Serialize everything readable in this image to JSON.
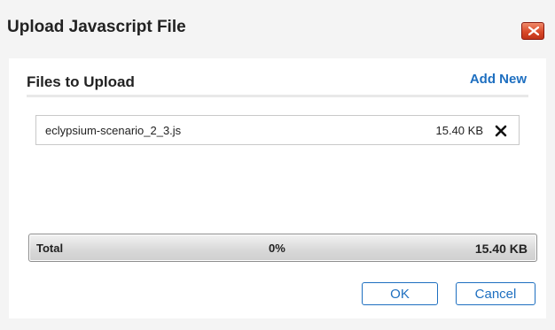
{
  "dialog": {
    "title": "Upload Javascript File"
  },
  "files": {
    "section_title": "Files to Upload",
    "add_new_label": "Add New",
    "items": [
      {
        "name": "eclypsium-scenario_2_3.js",
        "size": "15.40 KB"
      }
    ]
  },
  "total": {
    "label": "Total",
    "percent_text": "0%",
    "progress": 0,
    "size": "15.40 KB"
  },
  "buttons": {
    "ok_label": "OK",
    "cancel_label": "Cancel"
  },
  "colors": {
    "accent": "#1e6fc0",
    "close_button": "#d94a2a"
  },
  "icons": {
    "close": "close-icon",
    "remove": "x-icon"
  }
}
